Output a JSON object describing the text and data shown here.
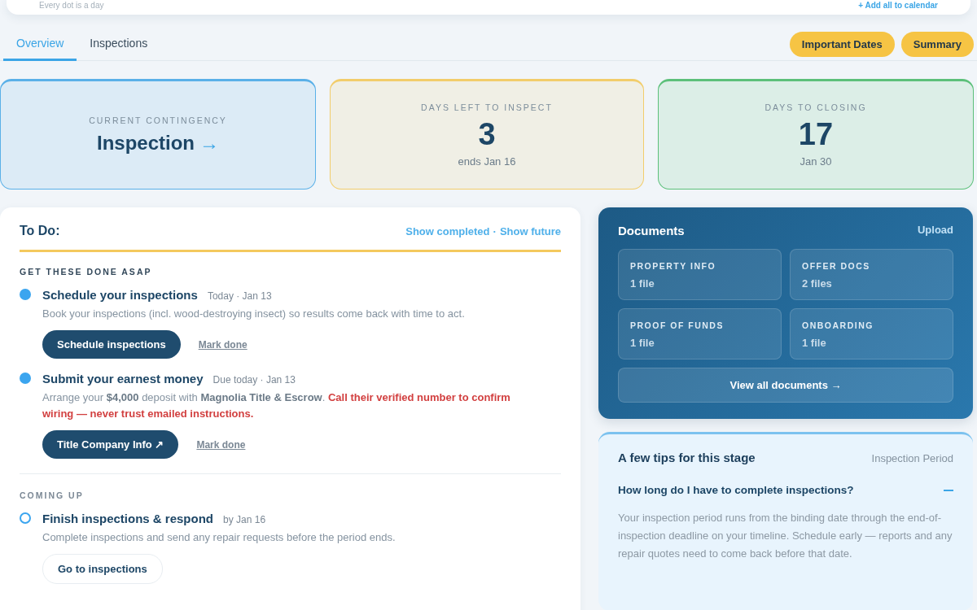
{
  "top_card": {
    "caption": "Every dot is a day",
    "link": "+ Add all to calendar"
  },
  "tabs": [
    {
      "label": "Overview",
      "selected": true
    },
    {
      "label": "Inspections",
      "selected": false
    }
  ],
  "header_buttons": [
    "Important Dates",
    "Summary"
  ],
  "stats": [
    {
      "kind": "link",
      "color": "#5ab0e8",
      "label": "CURRENT CONTINGENCY",
      "value": "Inspection",
      "arrow": "→"
    },
    {
      "kind": "count",
      "color": "#f2cd6b",
      "label": "DAYS LEFT TO INSPECT",
      "value": "3",
      "sub": "ends Jan 16"
    },
    {
      "kind": "count",
      "color": "#5cc07a",
      "label": "DAYS TO CLOSING",
      "value": "17",
      "sub": "Jan 30"
    }
  ],
  "todo": {
    "title": "To Do:",
    "links": [
      "Show completed",
      "Show future"
    ],
    "separator": "·",
    "sections": [
      {
        "heading": "GET THESE DONE ASAP",
        "items": [
          {
            "kind": "urgent",
            "title": "Schedule your inspections",
            "when": "Today · Jan 13",
            "text": "Book your inspections (incl. wood-destroying insect) so results come back with time to act.",
            "actions": [
              {
                "kind": "primary",
                "label": "Schedule inspections"
              },
              {
                "kind": "link",
                "label": "Mark done"
              }
            ]
          },
          {
            "kind": "urgent",
            "title": "Submit your earnest money",
            "when": "Due today · Jan 13",
            "text": "Arrange your **$4,000** deposit with **Magnolia Title & Escrow**.",
            "warning": "Call their verified number to confirm wiring — never trust emailed instructions.",
            "actions": [
              {
                "kind": "primary",
                "label": "Title Company Info ↗"
              },
              {
                "kind": "link",
                "label": "Mark done"
              }
            ]
          }
        ]
      },
      {
        "heading": "COMING UP",
        "items": [
          {
            "kind": "upcoming",
            "title": "Finish inspections & respond",
            "when": "by Jan 16",
            "text": "Complete inspections and send any repair requests before the period ends.",
            "actions": [
              {
                "kind": "secondary",
                "label": "Go to inspections"
              }
            ]
          }
        ]
      }
    ]
  },
  "documents": {
    "title": "Documents",
    "upload": "Upload",
    "folders": [
      {
        "name": "PROPERTY INFO",
        "count": "1 file"
      },
      {
        "name": "OFFER DOCS",
        "count": "2 files"
      },
      {
        "name": "PROOF OF FUNDS",
        "count": "1 file"
      },
      {
        "name": "ONBOARDING",
        "count": "1 file"
      }
    ],
    "view_all": "View all documents →"
  },
  "tips": {
    "title": "A few tips for this stage",
    "stage": "Inspection Period",
    "questions": [
      {
        "question": "How long do I have to complete inspections?",
        "expanded": true,
        "answer": "Your inspection period runs from the binding date through the end-of-inspection deadline on your timeline. Schedule early — reports and any repair quotes need to come back before that date."
      }
    ]
  }
}
